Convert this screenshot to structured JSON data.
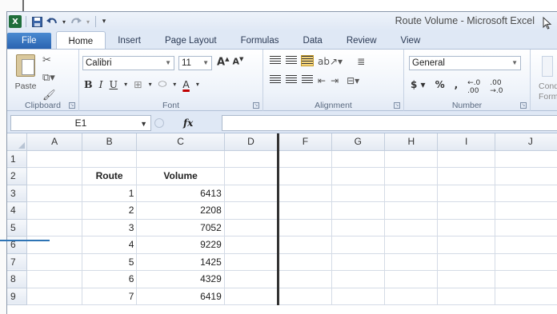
{
  "window": {
    "title": "Route Volume - Microsoft Excel"
  },
  "tabs": [
    {
      "label": "File"
    },
    {
      "label": "Home"
    },
    {
      "label": "Insert"
    },
    {
      "label": "Page Layout"
    },
    {
      "label": "Formulas"
    },
    {
      "label": "Data"
    },
    {
      "label": "Review"
    },
    {
      "label": "View"
    }
  ],
  "ribbon": {
    "clipboard": {
      "label": "Clipboard",
      "paste_label": "Paste"
    },
    "font": {
      "label": "Font",
      "name": "Calibri",
      "size": "11"
    },
    "alignment": {
      "label": "Alignment"
    },
    "number": {
      "label": "Number",
      "format": "General"
    },
    "styles": {
      "label": "Cond\nForm"
    }
  },
  "formula_bar": {
    "name_box": "E1",
    "fx_label": "fx",
    "formula": ""
  },
  "sheet": {
    "columns": [
      "A",
      "B",
      "C",
      "D",
      "F",
      "G",
      "H",
      "I",
      "J"
    ],
    "rows": [
      {
        "num": "1",
        "B": "",
        "C": ""
      },
      {
        "num": "2",
        "B": "Route",
        "C": "Volume"
      },
      {
        "num": "3",
        "B": "1",
        "C": "6413"
      },
      {
        "num": "4",
        "B": "2",
        "C": "2208"
      },
      {
        "num": "5",
        "B": "3",
        "C": "7052"
      },
      {
        "num": "6",
        "B": "4",
        "C": "9229"
      },
      {
        "num": "7",
        "B": "5",
        "C": "1425"
      },
      {
        "num": "8",
        "B": "6",
        "C": "4329"
      },
      {
        "num": "9",
        "B": "7",
        "C": "6419"
      }
    ]
  },
  "colors": {
    "file_tab": "#2a63b1",
    "accent_line": "#2e74b5",
    "header_bg": "#e4eaf3",
    "split_line": "#333333"
  }
}
